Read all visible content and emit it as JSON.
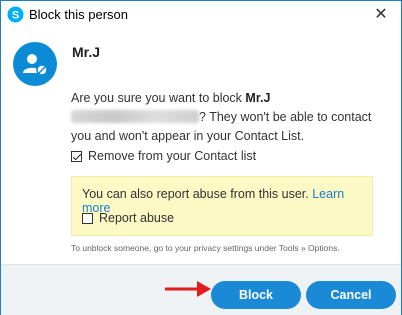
{
  "window": {
    "title": "Block this person"
  },
  "contact": {
    "name": "Mr.J"
  },
  "message": {
    "part1": "Are you sure you want to block ",
    "name": "Mr.J",
    "part2": "? They won't be able to contact you and won't appear in your Contact List."
  },
  "options": {
    "remove_label": "Remove from your Contact list",
    "remove_checked": true
  },
  "report": {
    "text": "You can also report abuse from this user. ",
    "learn_more": "Learn more",
    "checkbox_label": "Report abuse",
    "checkbox_checked": false
  },
  "footer_note": "To unblock someone, go to your privacy settings under Tools » Options.",
  "buttons": {
    "block": "Block",
    "cancel": "Cancel"
  },
  "colors": {
    "accent": "#1a8ad6",
    "link": "#1a7ccf",
    "report_bg": "#fcf9c4",
    "arrow": "#e21b1b"
  }
}
